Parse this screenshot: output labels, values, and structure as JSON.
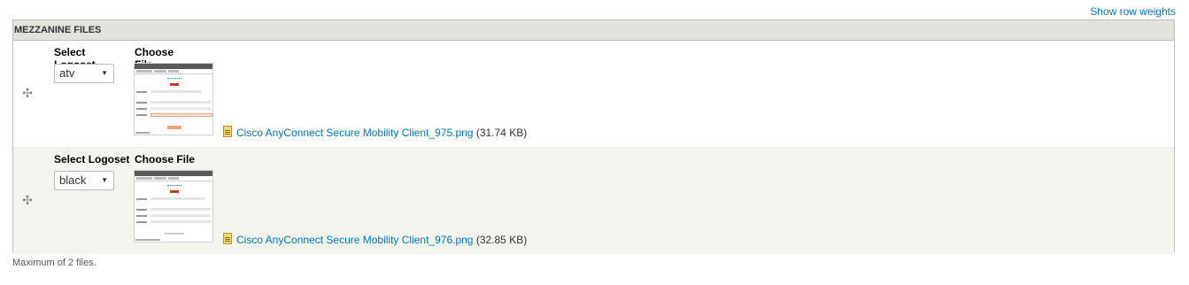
{
  "header": {
    "row_weights_link": "Show row weights"
  },
  "table": {
    "title": "MEZZANINE FILES",
    "rows": [
      {
        "logoset_label": "Select Logoset",
        "logoset_value": "atv",
        "file_label": "Choose File",
        "file_name": "Cisco AnyConnect Secure Mobility Client_975.png",
        "file_size": "(31.74 KB)"
      },
      {
        "logoset_label": "Select Logoset",
        "logoset_value": "black",
        "file_label": "Choose File",
        "file_name": "Cisco AnyConnect Secure Mobility Client_976.png",
        "file_size": "(32.85 KB)"
      }
    ]
  },
  "description": "Maximum of 2 files.",
  "icons": {
    "drag_handle": "move-cross-icon",
    "select_caret": "caret-down-icon",
    "file_type": "image-file-icon",
    "thumbnail": "cisco-anyconnect-screenshot-thumbnail"
  },
  "colors": {
    "link": "#0074bd",
    "header_bg": "#e1e2dc",
    "even_row_bg": "#f3f4ee"
  }
}
